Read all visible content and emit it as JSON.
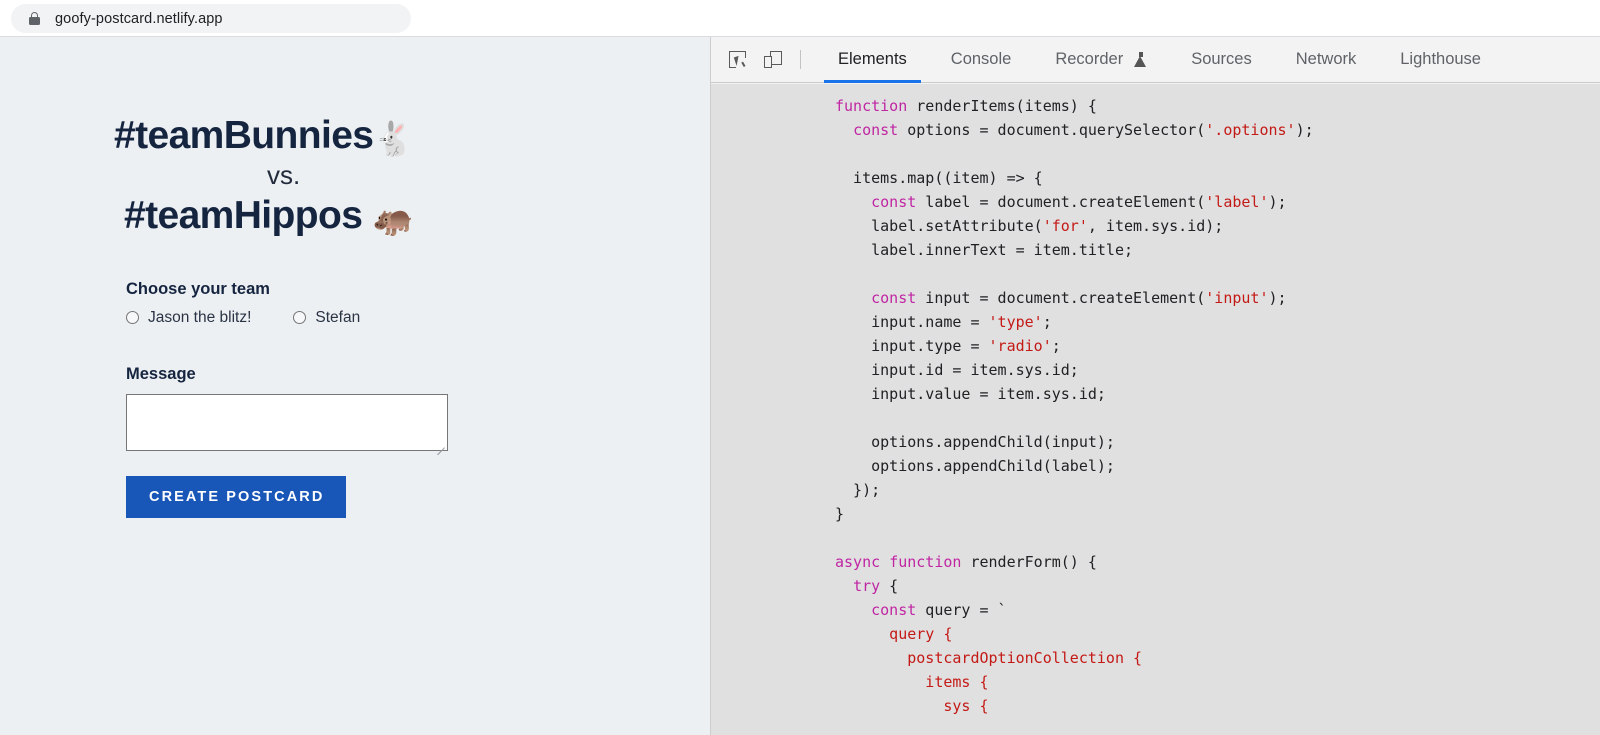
{
  "browser": {
    "lock_icon": "lock-icon",
    "url": "goofy-postcard.netlify.app"
  },
  "page": {
    "hero": {
      "line1_text": "#teamBunnies",
      "line1_emoji": "🐇",
      "vs": "vs.",
      "line2_text": "#teamHippos",
      "line2_emoji": "🦛"
    },
    "form": {
      "team_label": "Choose your team",
      "options": [
        {
          "label": "Jason the blitz!",
          "checked": false
        },
        {
          "label": "Stefan",
          "checked": false
        }
      ],
      "message_label": "Message",
      "message_value": "",
      "message_placeholder": "",
      "submit_label": "CREATE POSTCARD",
      "submit_color": "#1857b8"
    },
    "background_color": "#edf0f3",
    "heading_color": "#15243f"
  },
  "devtools": {
    "icons": [
      {
        "name": "inspect-element-icon"
      },
      {
        "name": "device-toolbar-icon"
      }
    ],
    "tabs": [
      {
        "label": "Elements",
        "active": true
      },
      {
        "label": "Console",
        "active": false
      },
      {
        "label": "Recorder",
        "active": false,
        "badge": "experiment-flask-icon"
      },
      {
        "label": "Sources",
        "active": false
      },
      {
        "label": "Network",
        "active": false
      },
      {
        "label": "Lighthouse",
        "active": false
      }
    ],
    "active_tab_underline_color": "#1a73e8",
    "panel_background": "#e0e0e0",
    "source_code_lines": [
      "function renderItems(items) {",
      "  const options = document.querySelector('.options');",
      "",
      "  items.map((item) => {",
      "    const label = document.createElement('label');",
      "    label.setAttribute('for', item.sys.id);",
      "    label.innerText = item.title;",
      "",
      "    const input = document.createElement('input');",
      "    input.name = 'type';",
      "    input.type = 'radio';",
      "    input.id = item.sys.id;",
      "    input.value = item.sys.id;",
      "",
      "    options.appendChild(input);",
      "    options.appendChild(label);",
      "  });",
      "}",
      "",
      "async function renderForm() {",
      "  try {",
      "    const query = `",
      "      query {",
      "        postcardOptionCollection {",
      "          items {",
      "            sys {"
    ]
  }
}
